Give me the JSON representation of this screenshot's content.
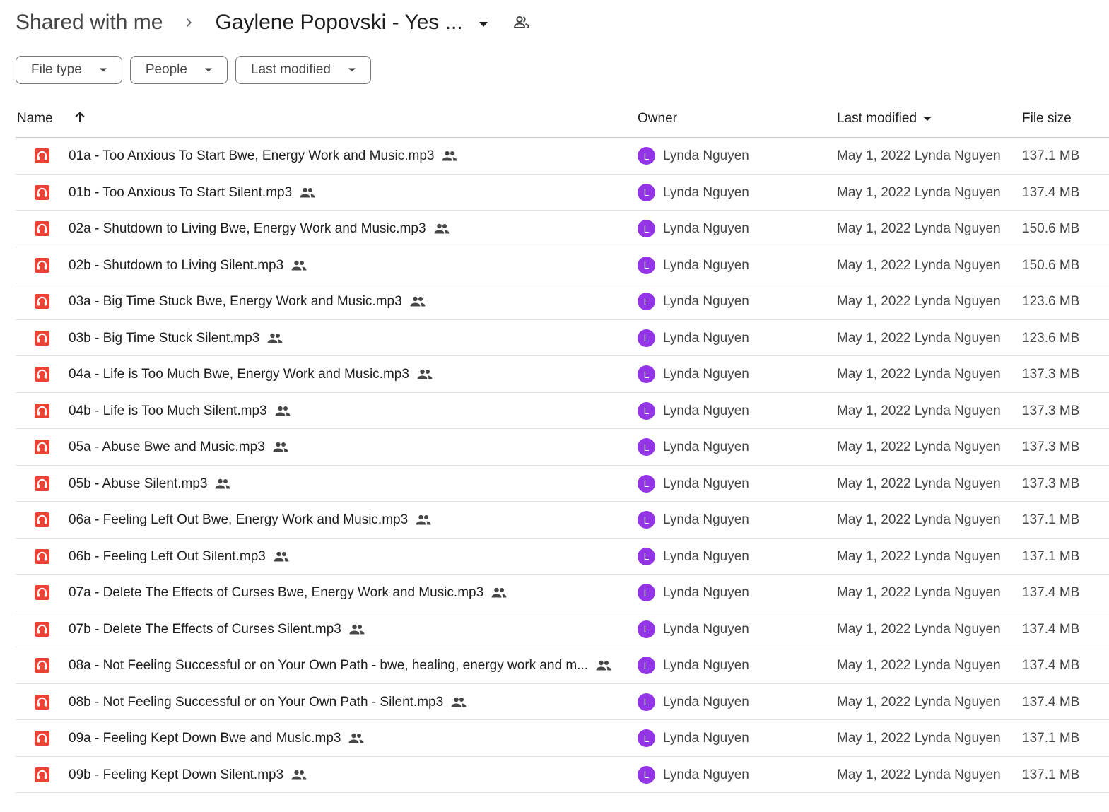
{
  "breadcrumb": {
    "root": "Shared with me",
    "current": "Gaylene Popovski - Yes ..."
  },
  "filters": [
    {
      "label": "File type"
    },
    {
      "label": "People"
    },
    {
      "label": "Last modified"
    }
  ],
  "table": {
    "headers": {
      "name": "Name",
      "owner": "Owner",
      "modified": "Last modified",
      "size": "File size"
    },
    "rows": [
      {
        "name": "01a - Too Anxious To Start Bwe, Energy Work and Music.mp3",
        "avatar": "L",
        "owner": "Lynda Nguyen",
        "modified": "May 1, 2022 Lynda Nguyen",
        "size": "137.1 MB"
      },
      {
        "name": "01b - Too Anxious To Start Silent.mp3",
        "avatar": "L",
        "owner": "Lynda Nguyen",
        "modified": "May 1, 2022 Lynda Nguyen",
        "size": "137.4 MB"
      },
      {
        "name": "02a - Shutdown to Living Bwe, Energy Work and Music.mp3",
        "avatar": "L",
        "owner": "Lynda Nguyen",
        "modified": "May 1, 2022 Lynda Nguyen",
        "size": "150.6 MB"
      },
      {
        "name": "02b - Shutdown to Living Silent.mp3",
        "avatar": "L",
        "owner": "Lynda Nguyen",
        "modified": "May 1, 2022 Lynda Nguyen",
        "size": "150.6 MB"
      },
      {
        "name": "03a - Big Time Stuck Bwe, Energy Work and Music.mp3",
        "avatar": "L",
        "owner": "Lynda Nguyen",
        "modified": "May 1, 2022 Lynda Nguyen",
        "size": "123.6 MB"
      },
      {
        "name": "03b - Big Time Stuck Silent.mp3",
        "avatar": "L",
        "owner": "Lynda Nguyen",
        "modified": "May 1, 2022 Lynda Nguyen",
        "size": "123.6 MB"
      },
      {
        "name": "04a - Life is Too Much Bwe, Energy Work and Music.mp3",
        "avatar": "L",
        "owner": "Lynda Nguyen",
        "modified": "May 1, 2022 Lynda Nguyen",
        "size": "137.3 MB"
      },
      {
        "name": "04b - Life is Too Much Silent.mp3",
        "avatar": "L",
        "owner": "Lynda Nguyen",
        "modified": "May 1, 2022 Lynda Nguyen",
        "size": "137.3 MB"
      },
      {
        "name": "05a - Abuse Bwe and Music.mp3",
        "avatar": "L",
        "owner": "Lynda Nguyen",
        "modified": "May 1, 2022 Lynda Nguyen",
        "size": "137.3 MB"
      },
      {
        "name": "05b - Abuse Silent.mp3",
        "avatar": "L",
        "owner": "Lynda Nguyen",
        "modified": "May 1, 2022 Lynda Nguyen",
        "size": "137.3 MB"
      },
      {
        "name": "06a - Feeling Left Out Bwe, Energy Work and Music.mp3",
        "avatar": "L",
        "owner": "Lynda Nguyen",
        "modified": "May 1, 2022 Lynda Nguyen",
        "size": "137.1 MB"
      },
      {
        "name": "06b - Feeling Left Out Silent.mp3",
        "avatar": "L",
        "owner": "Lynda Nguyen",
        "modified": "May 1, 2022 Lynda Nguyen",
        "size": "137.1 MB"
      },
      {
        "name": "07a - Delete The Effects of Curses Bwe, Energy Work and Music.mp3",
        "avatar": "L",
        "owner": "Lynda Nguyen",
        "modified": "May 1, 2022 Lynda Nguyen",
        "size": "137.4 MB"
      },
      {
        "name": "07b - Delete The Effects of Curses Silent.mp3",
        "avatar": "L",
        "owner": "Lynda Nguyen",
        "modified": "May 1, 2022 Lynda Nguyen",
        "size": "137.4 MB"
      },
      {
        "name": "08a - Not Feeling Successful or on Your Own Path - bwe, healing, energy work and m...",
        "avatar": "L",
        "owner": "Lynda Nguyen",
        "modified": "May 1, 2022 Lynda Nguyen",
        "size": "137.4 MB"
      },
      {
        "name": "08b - Not Feeling Successful or on Your Own Path - Silent.mp3",
        "avatar": "L",
        "owner": "Lynda Nguyen",
        "modified": "May 1, 2022 Lynda Nguyen",
        "size": "137.4 MB"
      },
      {
        "name": "09a - Feeling Kept Down Bwe and Music.mp3",
        "avatar": "L",
        "owner": "Lynda Nguyen",
        "modified": "May 1, 2022 Lynda Nguyen",
        "size": "137.1 MB"
      },
      {
        "name": "09b - Feeling Kept Down Silent.mp3",
        "avatar": "L",
        "owner": "Lynda Nguyen",
        "modified": "May 1, 2022 Lynda Nguyen",
        "size": "137.1 MB"
      }
    ]
  },
  "icons": {
    "breadcrumb_separator": "chevron-right-icon",
    "folder_menu": "caret-down-icon",
    "folder_shared": "people-outline-icon",
    "sort": "arrow-up-icon",
    "file": "audio-headphones-icon",
    "row_shared": "people-icon"
  },
  "colors": {
    "audio_icon": "#ea4335",
    "avatar": "#9334e6",
    "text_primary": "#1f1f1f",
    "text_secondary": "#444746"
  }
}
